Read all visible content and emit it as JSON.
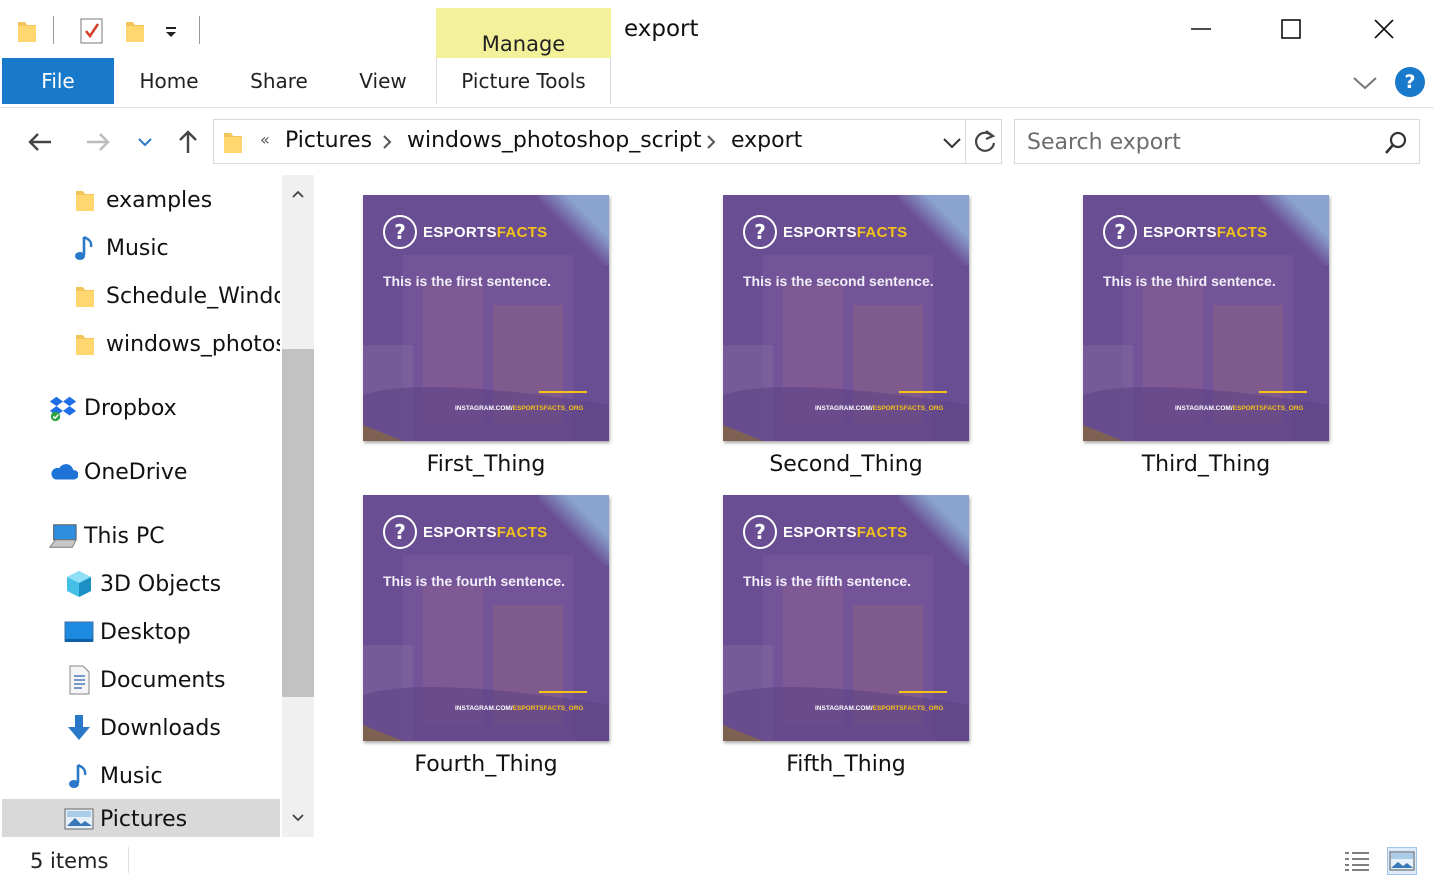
{
  "titlebar": {
    "window_title": "export",
    "context_tab_group": "Manage",
    "minimize_icon": "minimize-icon",
    "maximize_icon": "maximize-icon",
    "close_icon": "close-icon"
  },
  "ribbon": {
    "tabs": [
      {
        "label": "File"
      },
      {
        "label": "Home"
      },
      {
        "label": "Share"
      },
      {
        "label": "View"
      },
      {
        "label": "Picture Tools"
      }
    ],
    "accent_color": "#1979ca",
    "manage_color": "#f3f29a"
  },
  "address_bar": {
    "overflow": "«",
    "crumbs": [
      "Pictures",
      "windows_photoshop_script",
      "export"
    ]
  },
  "search": {
    "placeholder": "Search export"
  },
  "navigation_pane": {
    "items": [
      {
        "label": "examples",
        "icon": "folder-icon"
      },
      {
        "label": "Music",
        "icon": "music-icon"
      },
      {
        "label": "Schedule_Windo",
        "icon": "folder-icon"
      },
      {
        "label": "windows_photos",
        "icon": "folder-icon"
      },
      {
        "label": "Dropbox",
        "icon": "dropbox-icon"
      },
      {
        "label": "OneDrive",
        "icon": "onedrive-icon"
      },
      {
        "label": "This PC",
        "icon": "computer-icon"
      },
      {
        "label": "3D Objects",
        "icon": "cube-icon"
      },
      {
        "label": "Desktop",
        "icon": "desktop-icon"
      },
      {
        "label": "Documents",
        "icon": "documents-icon"
      },
      {
        "label": "Downloads",
        "icon": "download-icon"
      },
      {
        "label": "Music",
        "icon": "music-icon"
      },
      {
        "label": "Pictures",
        "icon": "pictures-icon",
        "selected": true
      }
    ]
  },
  "files": [
    {
      "name": "First_Thing",
      "sentence": "This is the first sentence."
    },
    {
      "name": "Second_Thing",
      "sentence": "This is the second sentence."
    },
    {
      "name": "Third_Thing",
      "sentence": "This is the third sentence."
    },
    {
      "name": "Fourth_Thing",
      "sentence": "This is the fourth sentence."
    },
    {
      "name": "Fifth_Thing",
      "sentence": "This is the fifth sentence."
    }
  ],
  "thumbnail_template": {
    "brand_main": "ESPORTS",
    "brand_accent": "FACTS",
    "footer_main": "INSTAGRAM.COM/",
    "footer_accent": "ESPORTSFACTS_ORG",
    "overlay_color": "#6a4e93",
    "accent_color": "#f5c218"
  },
  "statusbar": {
    "item_count": "5 items"
  }
}
